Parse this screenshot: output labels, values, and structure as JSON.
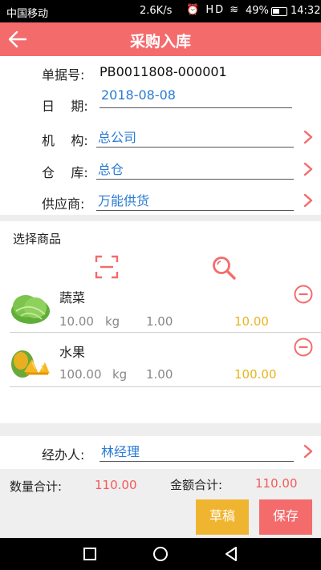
{
  "status_bar": {
    "carrier": "中国移动",
    "speed": "2.6K/s",
    "icons": "⏰ HD ≋",
    "battery_pct": "49%",
    "time": "14:32"
  },
  "header": {
    "title": "采购入库"
  },
  "form": {
    "doc_no_label": "单据号:",
    "doc_no_value": "PB0011808-000001",
    "date_label": "日    期:",
    "date_value": "2018-08-08",
    "org_label": "机    构:",
    "org_value": "总公司",
    "warehouse_label": "仓    库:",
    "warehouse_value": "总仓",
    "supplier_label": "供应商:",
    "supplier_value": "万能供货"
  },
  "products_section": {
    "title": "选择商品"
  },
  "products": [
    {
      "name": "蔬菜",
      "qty": "10.00",
      "unit": "kg",
      "price": "1.00",
      "amount": "10.00",
      "icon": "lettuce-thumb"
    },
    {
      "name": "水果",
      "qty": "100.00",
      "unit": "kg",
      "price": "1.00",
      "amount": "100.00",
      "icon": "mango-thumb"
    }
  ],
  "handler": {
    "label": "经办人:",
    "value": "林经理"
  },
  "footer": {
    "qty_total_label": "数量合计:",
    "qty_total_value": "110.00",
    "amount_total_label": "金额合计:",
    "amount_total_value": "110.00",
    "draft_label": "草稿",
    "save_label": "保存"
  },
  "colors": {
    "accent": "#f46b6c",
    "link": "#2a7bd4",
    "amount": "#e8b41e",
    "draft": "#f0b530"
  }
}
